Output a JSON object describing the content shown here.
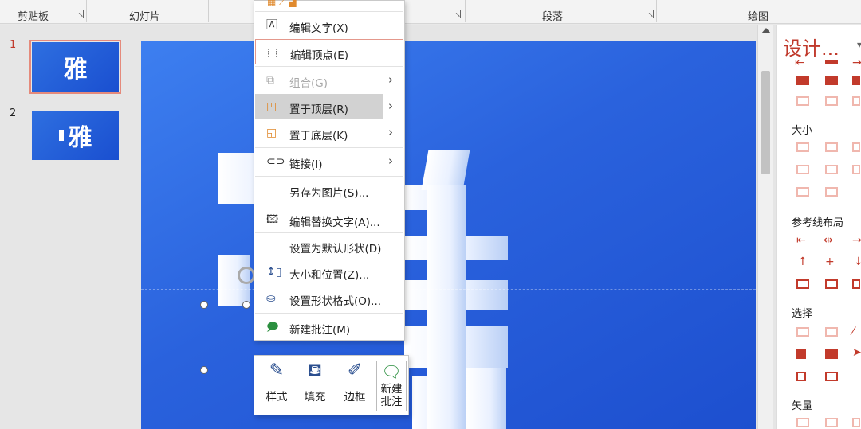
{
  "ribbon": {
    "groups": [
      "剪贴板",
      "幻灯片",
      "段落",
      "绘图"
    ]
  },
  "thumbnails": [
    {
      "number": "1",
      "text": "雅"
    },
    {
      "number": "2",
      "text": "雅"
    }
  ],
  "context_menu": {
    "items": [
      {
        "label": "编辑文字(X)",
        "icon": "edit-text-icon"
      },
      {
        "label": "编辑顶点(E)",
        "icon": "edit-points-icon"
      },
      {
        "label": "组合(G)",
        "icon": "group-icon",
        "disabled": true,
        "submenu": true
      },
      {
        "label": "置于顶层(R)",
        "icon": "bring-to-front-icon",
        "submenu": true
      },
      {
        "label": "置于底层(K)",
        "icon": "send-to-back-icon",
        "submenu": true
      },
      {
        "label": "链接(I)",
        "icon": "link-icon",
        "submenu": true
      },
      {
        "label": "另存为图片(S)...",
        "icon": ""
      },
      {
        "label": "编辑替换文字(A)...",
        "icon": "alt-text-icon"
      },
      {
        "label": "设置为默认形状(D)",
        "icon": ""
      },
      {
        "label": "大小和位置(Z)...",
        "icon": "size-position-icon"
      },
      {
        "label": "设置形状格式(O)...",
        "icon": "format-shape-icon"
      },
      {
        "label": "新建批注(M)",
        "icon": "new-comment-icon"
      }
    ]
  },
  "mini_toolbar": {
    "style": "样式",
    "fill": "填充",
    "outline": "边框",
    "new_comment_line1": "新建",
    "new_comment_line2": "批注"
  },
  "design_pane": {
    "title": "设计...",
    "sections": [
      "大小",
      "参考线布局",
      "选择",
      "矢量"
    ]
  },
  "colors": {
    "accent": "#c0392b",
    "slide_blue": "#2a62dd"
  }
}
